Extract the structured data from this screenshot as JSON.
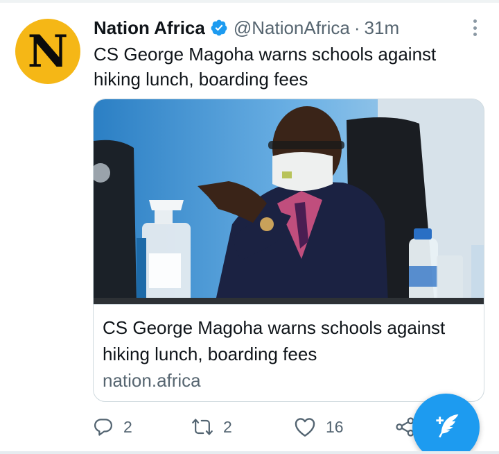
{
  "tweet": {
    "avatar_letter": "N",
    "display_name": "Nation Africa",
    "handle": "@NationAfrica",
    "separator": "·",
    "time": "31m",
    "text": "CS George Magoha warns schools against hiking lunch, boarding fees",
    "verified": true
  },
  "card": {
    "title": "CS George Magoha warns schools against hiking lunch, boarding fees",
    "domain": "nation.africa"
  },
  "actions": {
    "reply_count": "2",
    "retweet_count": "2",
    "like_count": "16"
  },
  "colors": {
    "accent": "#1d9bf0",
    "avatar_bg": "#f5b716",
    "secondary_text": "#566570",
    "border": "#cfd9de"
  },
  "icons": [
    "verified-badge-icon",
    "more-icon",
    "reply-icon",
    "retweet-icon",
    "like-icon",
    "share-icon",
    "compose-tweet-icon"
  ]
}
